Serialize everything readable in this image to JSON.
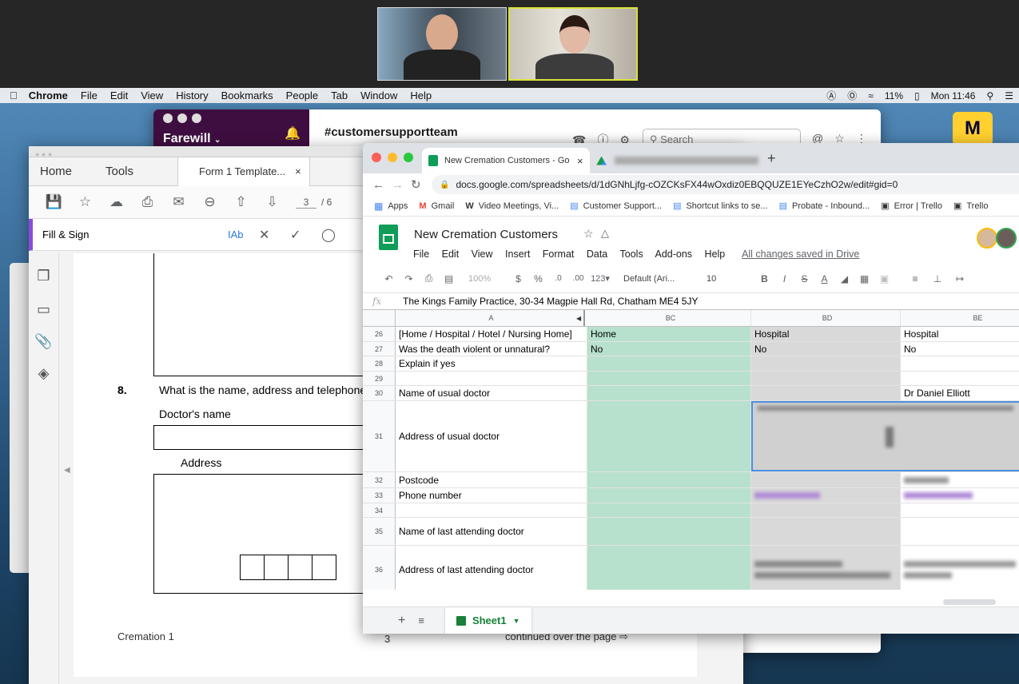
{
  "menubar": {
    "app": "Chrome",
    "items": [
      "File",
      "Edit",
      "View",
      "History",
      "Bookmarks",
      "People",
      "Tab",
      "Window",
      "Help"
    ],
    "battery": "11%",
    "clock": "Mon 11:46"
  },
  "slack": {
    "workspace": "Farewill",
    "channel": "#customersupportteam",
    "search": "Search"
  },
  "acrobat": {
    "tabs": [
      "Home",
      "Tools",
      "Form 1 Template..."
    ],
    "page": "3",
    "pages": "/ 6",
    "fill_sign": "Fill & Sign",
    "q_num": "8.",
    "question": "What is the name, address and telephone",
    "doctor_label": "Doctor's name",
    "address_label": "Address",
    "footer_left": "Cremation 1",
    "footer_page": "3",
    "footer_cont": "continued over the page ⇨"
  },
  "chrome": {
    "tab_title": "New Cremation Customers - Go",
    "url": "docs.google.com/spreadsheets/d/1dGNhLjfg-cOZCKsFX44wOxdiz0EBQQUZE1EYeCzhO2w/edit#gid=0",
    "bookmarks": [
      "Apps",
      "Gmail",
      "Video Meetings, Vi...",
      "Customer Support...",
      "Shortcut links to se...",
      "Probate - Inbound...",
      "Error | Trello",
      "Trello"
    ]
  },
  "sheet": {
    "title": "New Cremation Customers",
    "menu": [
      "File",
      "Edit",
      "View",
      "Insert",
      "Format",
      "Data",
      "Tools",
      "Add-ons",
      "Help"
    ],
    "saved": "All changes saved in Drive",
    "zoom": "100%",
    "font": "Default (Ari...",
    "size": "10",
    "formula": "The Kings Family Practice, 30-34 Magpie Hall Rd, Chatham ME4 5JY",
    "columns": [
      "A",
      "BC",
      "BD",
      "BE"
    ],
    "tab": "Sheet1"
  },
  "rows": [
    {
      "n": "26",
      "a": "[Home / Hospital / Hotel / Nursing Home]",
      "bc": "Home",
      "bd": "Hospital",
      "be": "Hospital"
    },
    {
      "n": "27",
      "a": "Was the death violent or unnatural?",
      "bc": "No",
      "bd": "No",
      "be": "No"
    },
    {
      "n": "28",
      "a": "Explain if yes",
      "bc": "",
      "bd": "",
      "be": ""
    },
    {
      "n": "29",
      "a": "",
      "bc": "",
      "bd": "",
      "be": ""
    },
    {
      "n": "30",
      "a": "Name of usual doctor",
      "bc": "",
      "bd": "",
      "be": "Dr Daniel Elliott"
    },
    {
      "n": "31",
      "a": "Address of usual doctor",
      "bc": "",
      "bd": "",
      "be": ""
    },
    {
      "n": "32",
      "a": "Postcode",
      "bc": "",
      "bd": "",
      "be": ""
    },
    {
      "n": "33",
      "a": "Phone number",
      "bc": "",
      "bd": "",
      "be": ""
    },
    {
      "n": "34",
      "a": "",
      "bc": "",
      "bd": "",
      "be": ""
    },
    {
      "n": "35",
      "a": "Name of last attending doctor",
      "bc": "",
      "bd": "",
      "be": ""
    },
    {
      "n": "36",
      "a": "Address of last attending doctor",
      "bc": "",
      "bd": "",
      "be": ""
    }
  ]
}
